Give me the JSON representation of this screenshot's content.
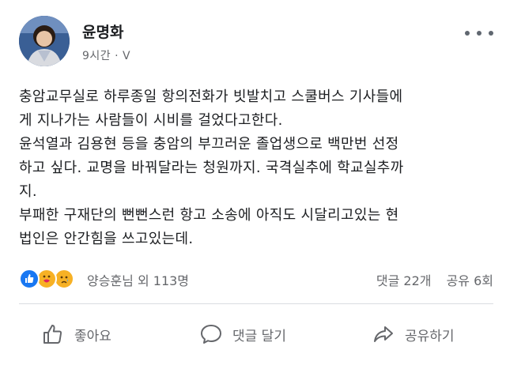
{
  "post": {
    "author": "윤명화",
    "meta": "9시간 · V",
    "lines": [
      "충암교무실로 하루종일 항의전화가 빗발치고 스쿨버스 기사들에",
      "게 지나가는 사람들이 시비를 걸었다고한다.",
      "윤석열과 김용현 등을 충암의 부끄러운 졸업생으로 백만번 선정",
      "하고 싶다. 교명을 바꿔달라는 청원까지. 국격실추에  학교실추까",
      "지.",
      "부패한 구재단의 뻔뻔스런  항고 소송에 아직도 시달리고있는  현",
      "법인은 안간힘을 쓰고있는데."
    ]
  },
  "reactions": {
    "summary": "양승훈님 외 113명",
    "comments": "댓글 22개",
    "shares": "공유 6회",
    "icons": [
      "like-icon",
      "care-icon",
      "sad-icon"
    ]
  },
  "actions": {
    "like": "좋아요",
    "comment": "댓글 달기",
    "share": "공유하기"
  },
  "colors": {
    "like_blue": "#1877f2",
    "text": "#1c1e21",
    "muted": "#65676b"
  }
}
